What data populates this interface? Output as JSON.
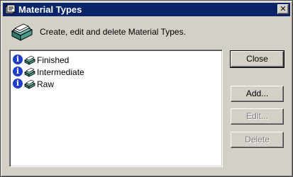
{
  "window": {
    "title": "Material Types",
    "close_glyph": "✕"
  },
  "header": {
    "description": "Create, edit and delete Material Types."
  },
  "list": {
    "items": [
      {
        "label": "Finished",
        "info_glyph": "i"
      },
      {
        "label": "Intermediate",
        "info_glyph": "i"
      },
      {
        "label": "Raw",
        "info_glyph": "i"
      }
    ]
  },
  "buttons": {
    "close": "Close",
    "add": "Add...",
    "edit": "Edit...",
    "delete": "Delete"
  },
  "icons": {
    "title": "app-icon",
    "header": "card-stack-icon",
    "info": "info-icon",
    "item": "material-stack-icon"
  },
  "colors": {
    "titlebar": "#0a246a",
    "face": "#d4d0c8",
    "info_blue": "#1e3cc8",
    "icon_teal": "#6fb8a8"
  }
}
